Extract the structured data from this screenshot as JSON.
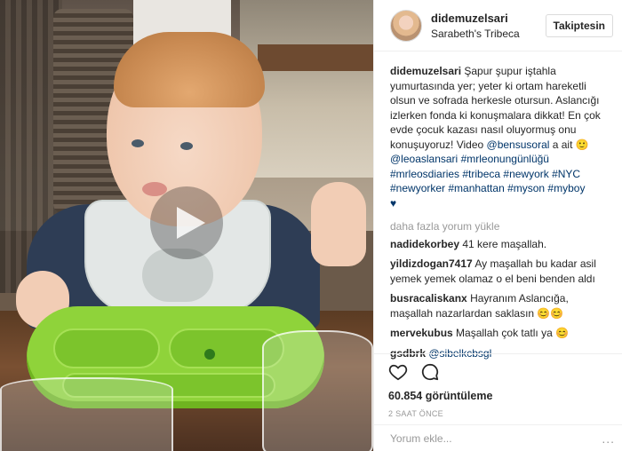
{
  "header": {
    "username": "didemuzelsari",
    "location": "Sarabeth's Tribeca",
    "follow_label": "Takiptesin"
  },
  "caption": {
    "username": "didemuzelsari",
    "text_1": "Şapur şupur iştahla yumurtasında yer; yeter ki ortam hareketli olsun ve sofrada herkesle otursun. Aslancığı izlerken fonda ki konuşmalara dikkat! En çok evde çocuk kazası nasıl oluyormuş onu konuşuyoruz! Video ",
    "mention_1": "@bensusoral",
    "text_2": " a ait ",
    "emoji_1": "🙂",
    "mention_2": "@leoaslansari",
    "hashtags_1": "#mrleonungünlüğü",
    "hashtags_2": "#mrleosdiaries #tribeca #newyork #NYC",
    "hashtags_3": "#newyorker #manhattan #myson #myboy",
    "heart": "♥"
  },
  "load_more": "daha fazla yorum yükle",
  "comments": [
    {
      "user": "nadidekorbey",
      "text": "41 kere maşallah."
    },
    {
      "user": "yildizdogan7417",
      "text": "Ay maşallah bu kadar asil yemek yemek olamaz o el beni benden aldı"
    },
    {
      "user": "busracaliskanx",
      "text": "Hayranım Aslancığa, maşallah nazarlardan saklasın 😊😊"
    },
    {
      "user": "mervekubus",
      "text": "Maşallah çok tatlı ya 😊"
    },
    {
      "user": "gsdbrk",
      "text": "",
      "mention": "@sibelkcbsgl"
    }
  ],
  "stats": {
    "views": "60.854 görüntüleme",
    "time": "2 SAAT ÖNCE"
  },
  "add_comment": {
    "placeholder": "Yorum ekle...",
    "options": "..."
  },
  "icons": {
    "like": "heart-outline-icon",
    "comment": "speech-bubble-icon",
    "play": "play-icon"
  },
  "colors": {
    "link": "#003569",
    "muted": "#999999",
    "text": "#262626",
    "border": "#efefef"
  }
}
